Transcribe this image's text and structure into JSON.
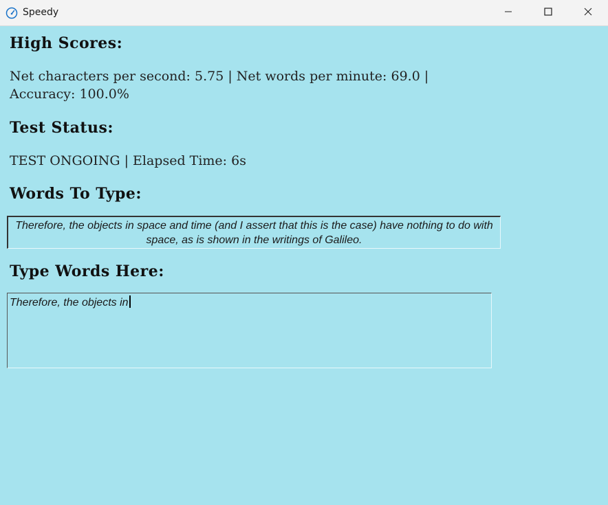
{
  "window": {
    "title": "Speedy",
    "icon": "speedometer-icon",
    "controls": {
      "minimize_icon": "minimize-icon",
      "maximize_icon": "maximize-icon",
      "close_icon": "close-icon"
    }
  },
  "high_scores": {
    "heading": "High Scores:",
    "line1": "Net characters per second: 5.75 | Net words per minute: 69.0 |",
    "line2": "Accuracy: 100.0%"
  },
  "test_status": {
    "heading": "Test Status:",
    "text": "TEST ONGOING | Elapsed Time: 6s"
  },
  "words_to_type": {
    "heading": "Words To Type:",
    "text": "Therefore, the objects in space and time (and I assert that this is the case) have nothing to do with space, as is shown in the writings of Galileo."
  },
  "type_words": {
    "heading": "Type Words Here:",
    "value": "Therefore, the objects in"
  },
  "colors": {
    "background": "#a6e3ee",
    "titlebar": "#f3f3f3",
    "icon_accent": "#1a73c9"
  }
}
